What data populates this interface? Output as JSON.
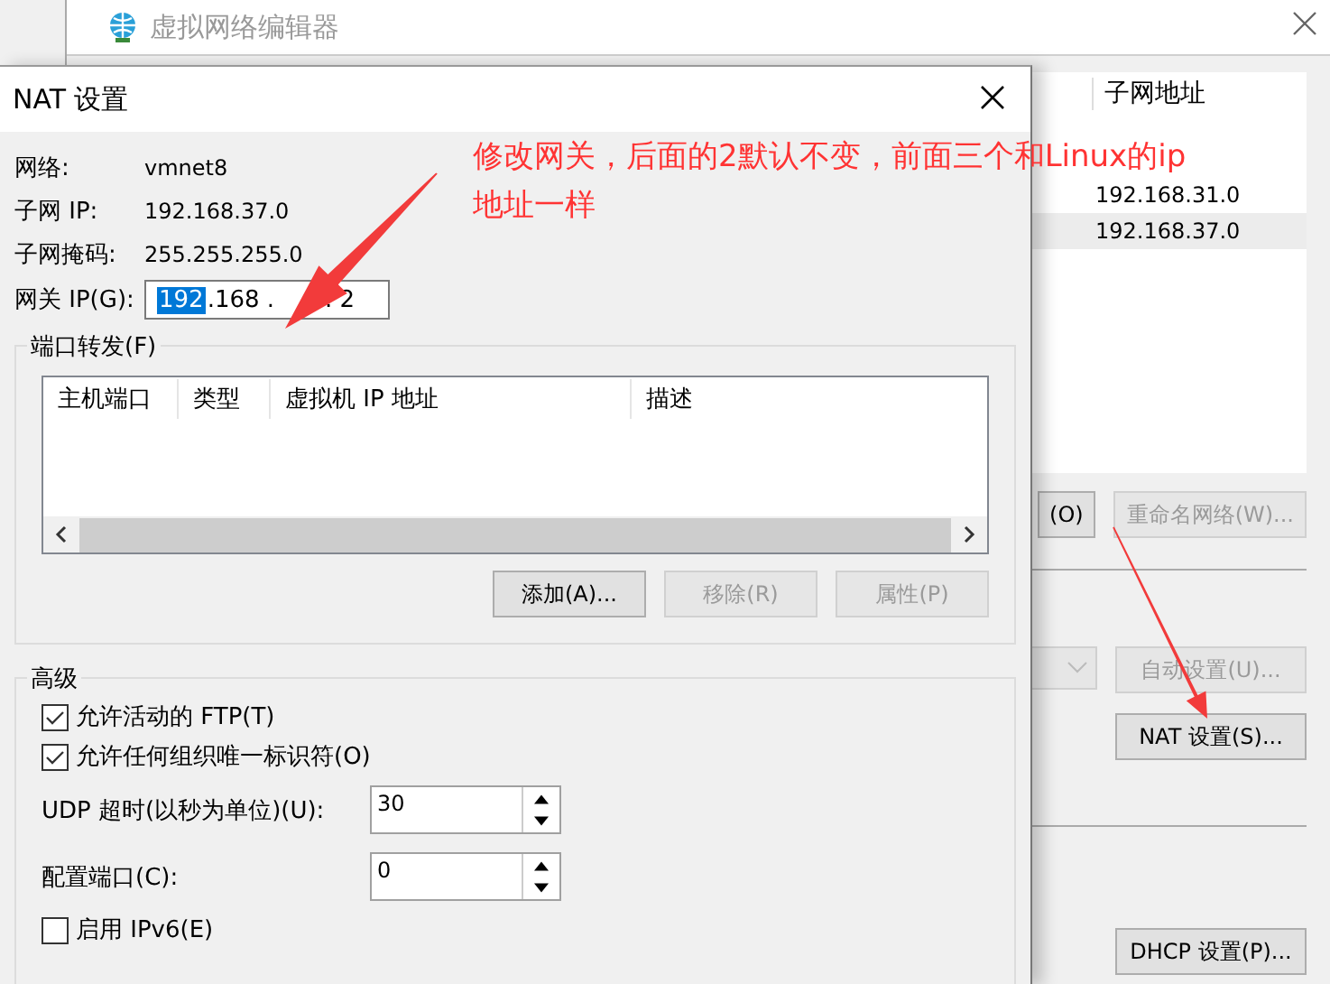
{
  "background_window": {
    "title": "虚拟网络编辑器",
    "table": {
      "columns": [
        "子网地址"
      ],
      "rows": [
        {
          "cells": [
            "192.168.31.0"
          ],
          "selected": false
        },
        {
          "cells": [
            "192.168.37.0"
          ],
          "selected": true
        }
      ]
    },
    "top_buttons": [
      {
        "label": "(O)",
        "disabled": false
      },
      {
        "label": "重命名网络(W)...",
        "disabled": true
      }
    ],
    "combo": {
      "disabled": true
    },
    "auto_button": {
      "label": "自动设置(U)...",
      "disabled": true
    },
    "nat_button": {
      "label": "NAT 设置(S)...",
      "disabled": false
    },
    "dhcp_button": {
      "label": "DHCP 设置(P)...",
      "disabled": false
    }
  },
  "dialog": {
    "title": "NAT 设置",
    "info": [
      {
        "label": "网络:",
        "value": "vmnet8"
      },
      {
        "label": "子网 IP:",
        "value": "192.168.37.0"
      },
      {
        "label": "子网掩码:",
        "value": "255.255.255.0"
      }
    ],
    "gateway": {
      "label": "网关 IP(G):",
      "parts": [
        {
          "text": "192",
          "selected": true
        },
        {
          "text": ".168 .",
          "selected": false
        },
        {
          "text": ". 2",
          "selected": false
        }
      ]
    },
    "port_forwarding": {
      "title": "端口转发(F)",
      "columns": [
        "主机端口",
        "类型",
        "虚拟机 IP 地址",
        "描述"
      ],
      "buttons": [
        {
          "label": "添加(A)...",
          "disabled": false
        },
        {
          "label": "移除(R)",
          "disabled": true
        },
        {
          "label": "属性(P)",
          "disabled": true
        }
      ]
    },
    "advanced": {
      "title": "高级",
      "items": [
        {
          "kind": "checkbox",
          "label": "允许活动的 FTP(T)",
          "checked": true
        },
        {
          "kind": "checkbox",
          "label": "允许任何组织唯一标识符(O)",
          "checked": true
        },
        {
          "kind": "spinner",
          "label": "UDP 超时(以秒为单位)(U):",
          "value": "30"
        },
        {
          "kind": "spinner",
          "label": "配置端口(C):",
          "value": "0"
        },
        {
          "kind": "checkbox",
          "label": "启用 IPv6(E)",
          "checked": false
        }
      ]
    }
  },
  "annotation": {
    "lines": [
      "修改网关，后面的2默认不变，前面三个和Linux的ip",
      "地址一样"
    ]
  }
}
